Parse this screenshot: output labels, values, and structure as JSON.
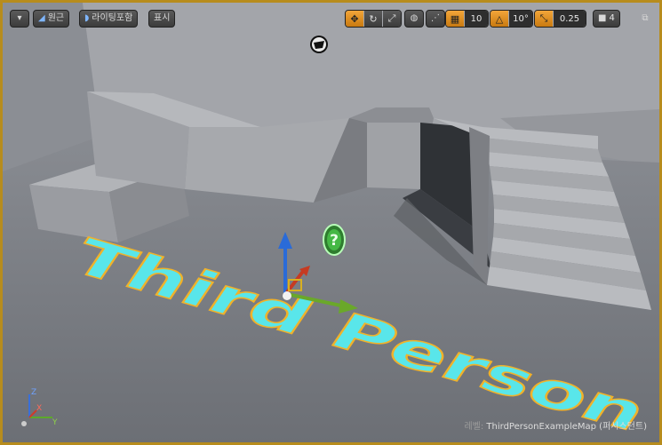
{
  "toolbar": {
    "perspective_label": "원근",
    "lit_label": "라이팅포함",
    "show_label": "표시",
    "grid_snap_value": "10",
    "rotation_snap_value": "10°",
    "scale_snap_value": "0.25",
    "camera_speed_value": "4"
  },
  "scene": {
    "floor_text": "Third Person",
    "floor_text_color": "#59e6ea",
    "floor_text_outline": "#f0b22a"
  },
  "status": {
    "map_prefix": "레벨:",
    "map_name": "ThirdPersonExampleMap (퍼시스턴트)"
  },
  "axis": {
    "x_label": "X",
    "y_label": "Y",
    "z_label": "Z"
  },
  "colors": {
    "accent": "#f0a030",
    "border": "#b78c1d"
  }
}
